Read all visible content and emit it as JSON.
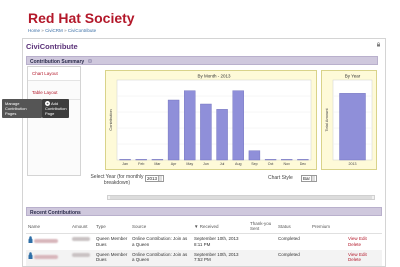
{
  "site": {
    "title": "Red Hat Society"
  },
  "breadcrumb": {
    "home": "Home",
    "civicrm": "CiviCRM",
    "current": "CiviContribute",
    "sep": "»"
  },
  "page": {
    "title": "CiviContribute"
  },
  "summary": {
    "title": "Contribution Summary"
  },
  "side_tabs": [
    {
      "label": "Chart Layout"
    },
    {
      "label": "Table Layout"
    }
  ],
  "tooltips": {
    "manage": "Manage Contribution Pages",
    "add": "Add Contribution Page"
  },
  "controls": {
    "year_label": "Select Year (for monthly breakdown)",
    "year_value": "2013",
    "style_label": "Chart Style",
    "style_value": "Bar"
  },
  "recent": {
    "title": "Recent Contributions",
    "columns": [
      "Name",
      "Amount",
      "Type",
      "Source",
      "Received",
      "Thank-you Sent",
      "Status",
      "Premium",
      ""
    ],
    "received_sort_marker": "▼",
    "rows": [
      {
        "type": "Queen Member Dues",
        "source": "Online Contribution: Join as a Queen",
        "received": "September 10th, 2013 8:11 PM",
        "status": "Completed",
        "actions": [
          "View",
          "Edit",
          "Delete"
        ]
      },
      {
        "type": "Queen Member Dues",
        "source": "Online Contribution: Join as a Queen",
        "received": "September 10th, 2013 7:52 PM",
        "status": "Completed",
        "actions": [
          "View",
          "Edit",
          "Delete"
        ]
      }
    ]
  },
  "chart_data": [
    {
      "type": "bar",
      "title": "By Month - 2013",
      "ylabel": "Contribution",
      "categories": [
        "Jan",
        "Feb",
        "Mar",
        "Apr",
        "May",
        "Jun",
        "Jul",
        "Aug",
        "Sep",
        "Oct",
        "Nov",
        "Dec"
      ],
      "values": [
        0,
        0,
        0,
        45,
        52,
        42,
        38,
        52,
        7,
        0,
        0,
        0
      ],
      "ylim": [
        0,
        60
      ]
    },
    {
      "type": "bar",
      "title": "By Year",
      "ylabel": "Total Amount",
      "categories": [
        "2013"
      ],
      "values": [
        100
      ],
      "ylim": [
        0,
        120
      ]
    }
  ],
  "colors": {
    "brand": "#b3182a",
    "page_title": "#5b3279",
    "bar_fill": "#8f8fd9",
    "chart_bg": "#fefad8"
  }
}
